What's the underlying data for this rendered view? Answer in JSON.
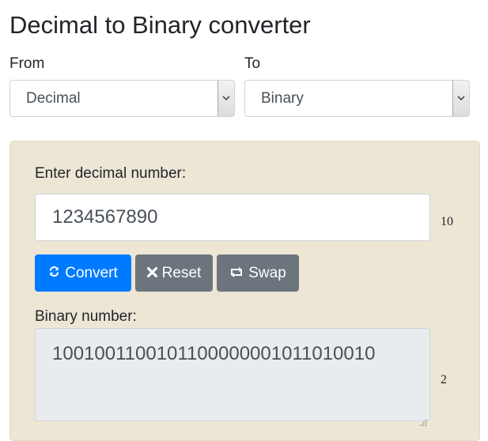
{
  "page": {
    "title": "Decimal to Binary converter"
  },
  "from": {
    "label": "From",
    "selected": "Decimal"
  },
  "to": {
    "label": "To",
    "selected": "Binary"
  },
  "input": {
    "label": "Enter decimal number:",
    "value": "1234567890",
    "base": "10"
  },
  "buttons": {
    "convert": "Convert",
    "reset": "Reset",
    "swap": "Swap"
  },
  "output": {
    "label": "Binary number:",
    "value": "1001001100101100000001011010010",
    "base": "2"
  },
  "icons": {
    "convert": "refresh-icon",
    "reset": "x-icon",
    "swap": "swap-icon",
    "select": "chevron-down-icon"
  },
  "colors": {
    "primary": "#007bff",
    "secondary": "#6c757d",
    "panel": "#ede6d5"
  }
}
